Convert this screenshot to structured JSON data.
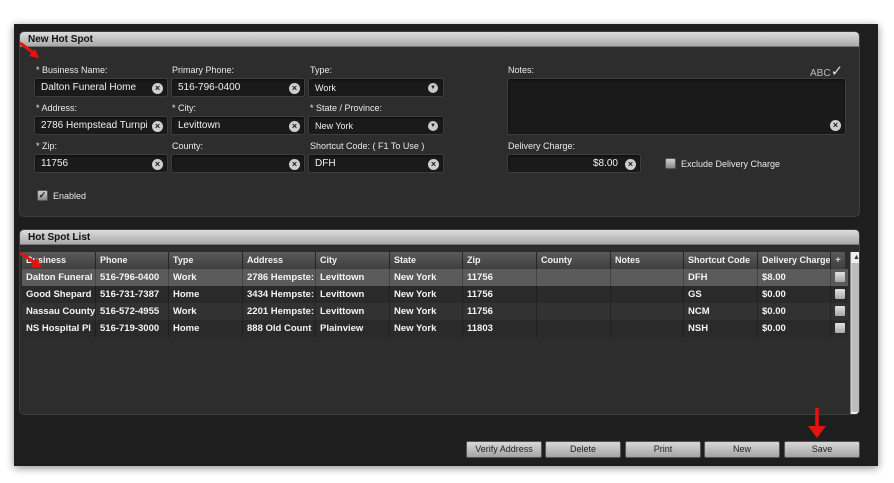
{
  "form": {
    "title": "New Hot Spot",
    "business_name": {
      "label": "* Business Name:",
      "value": "Dalton Funeral Home"
    },
    "primary_phone": {
      "label": "Primary Phone:",
      "value": "516-796-0400"
    },
    "type": {
      "label": "Type:",
      "value": "Work"
    },
    "notes": {
      "label": "Notes:",
      "value": ""
    },
    "spellcheck": "ABC",
    "address": {
      "label": "* Address:",
      "value": "2786 Hempstead Turnpi"
    },
    "city": {
      "label": "* City:",
      "value": "Levittown"
    },
    "state": {
      "label": "* State / Province:",
      "value": "New York"
    },
    "zip": {
      "label": "* Zip:",
      "value": "11756"
    },
    "county": {
      "label": "County:",
      "value": ""
    },
    "shortcut": {
      "label": "Shortcut Code: ( F1 To Use )",
      "value": "DFH"
    },
    "delivery_charge": {
      "label": "Delivery Charge:",
      "value": "$8.00"
    },
    "exclude_delivery": {
      "label": "Exclude Delivery Charge",
      "checked": false
    },
    "enabled": {
      "label": "Enabled",
      "checked": true
    }
  },
  "list": {
    "title": "Hot Spot List",
    "columns": [
      "Business",
      "Phone",
      "Type",
      "Address",
      "City",
      "State",
      "Zip",
      "County",
      "Notes",
      "Shortcut Code",
      "Delivery Charge"
    ],
    "add_column": "+",
    "rows": [
      [
        "Dalton Funeral",
        "516-796-0400",
        "Work",
        "2786 Hempste:",
        "Levittown",
        "New York",
        "11756",
        "",
        "",
        "DFH",
        "$8.00"
      ],
      [
        "Good Shepard",
        "516-731-7387",
        "Home",
        "3434 Hempste:",
        "Levittown",
        "New York",
        "11756",
        "",
        "",
        "GS",
        "$0.00"
      ],
      [
        "Nassau County",
        "516-572-4955",
        "Work",
        "2201 Hempste:",
        "Levittown",
        "New York",
        "11756",
        "",
        "",
        "NCM",
        "$0.00"
      ],
      [
        "NS Hospital Pl",
        "516-719-3000",
        "Home",
        "888 Old Count",
        "Plainview",
        "New York",
        "11803",
        "",
        "",
        "NSH",
        "$0.00"
      ]
    ]
  },
  "buttons": {
    "verify": "Verify Address",
    "delete": "Delete",
    "print": "Print",
    "new": "New",
    "save": "Save"
  },
  "colors": {
    "annotation_arrow": "#e8120c",
    "window_bg": "#1e1e1e",
    "panel_bg": "#2d2d2d",
    "selected_row": "#5b5b5b"
  }
}
